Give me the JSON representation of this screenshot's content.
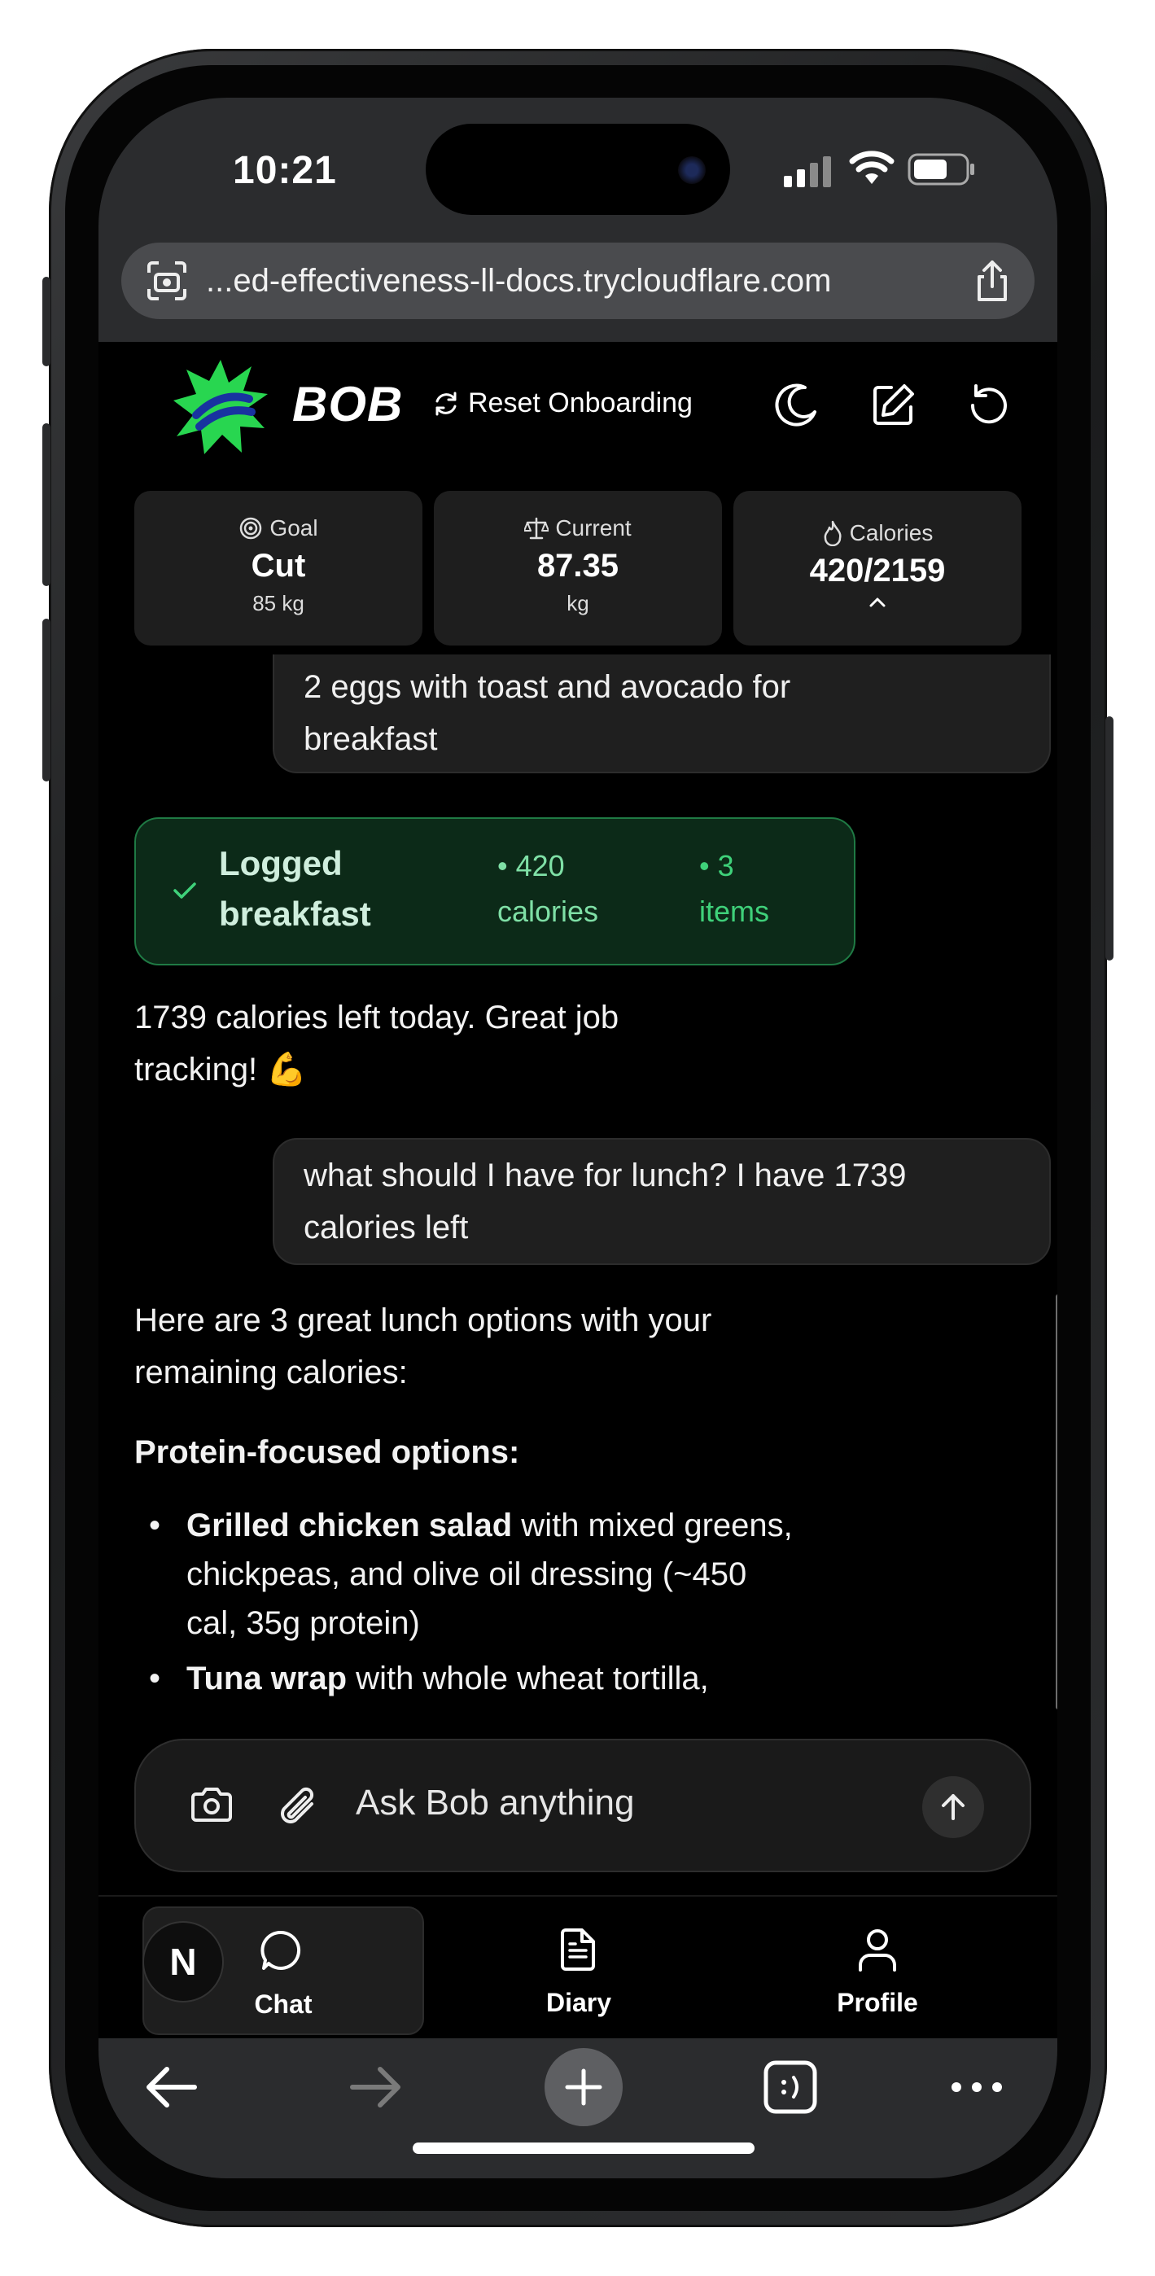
{
  "status": {
    "time": "10:21"
  },
  "browser": {
    "url": "...ed-effectiveness-ll-docs.trycloudflare.com"
  },
  "header": {
    "brand": "BOB",
    "reset_label": "Reset Onboarding"
  },
  "stats": {
    "goal": {
      "label": "Goal",
      "value": "Cut",
      "sub": "85 kg"
    },
    "current": {
      "label": "Current",
      "value": "87.35",
      "sub": "kg"
    },
    "calories": {
      "label": "Calories",
      "value": "420/2159"
    }
  },
  "chat": {
    "user_msg_1": {
      "line1": "2 eggs with toast and avocado for",
      "line2": "breakfast"
    },
    "logged": {
      "title_line1": "Logged",
      "title_line2": "breakfast",
      "calories_line1": "• 420",
      "calories_line2": "calories",
      "items_line1": "• 3",
      "items_line2": "items"
    },
    "assistant_msg_1": {
      "line1": "1739 calories left today. Great job",
      "line2": "tracking! 💪"
    },
    "user_msg_2": {
      "line1": "what should I have for lunch? I have 1739",
      "line2": "calories left"
    },
    "assistant_msg_2": {
      "intro_line1": "Here are 3 great lunch options with your",
      "intro_line2": "remaining calories:",
      "section": "Protein-focused options:",
      "items": [
        {
          "bold": "Grilled chicken salad",
          "line1": " with mixed greens,",
          "line2": "chickpeas, and olive oil dressing (~450",
          "line3": "cal, 35g protein)"
        },
        {
          "bold": "Tuna wrap",
          "line1": " with whole wheat tortilla,"
        }
      ]
    }
  },
  "input": {
    "placeholder": "Ask Bob anything"
  },
  "tabs": [
    {
      "label": "Chat"
    },
    {
      "label": "Diary"
    },
    {
      "label": "Profile"
    }
  ],
  "avatar": {
    "initial": "N"
  }
}
